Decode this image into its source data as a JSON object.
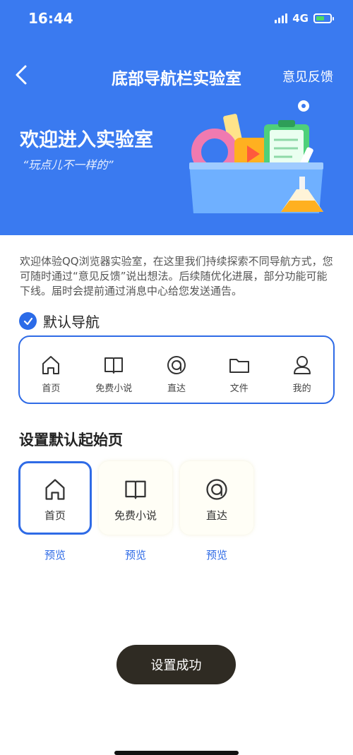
{
  "status_bar": {
    "time": "16:44",
    "network": "4G"
  },
  "nav": {
    "title": "底部导航栏实验室",
    "feedback": "意见反馈"
  },
  "hero": {
    "title": "欢迎进入实验室",
    "slogan": "“玩点儿不一样的”"
  },
  "intro": "欢迎体验QQ浏览器实验室，在这里我们持续探索不同导航方式，您可随时通过“意见反馈”说出想法。后续随优化进展，部分功能可能下线。届时会提前通过消息中心给您发送通告。",
  "default_nav": {
    "label": "默认导航",
    "checked": true,
    "items": [
      {
        "label": "首页",
        "icon": "home-icon"
      },
      {
        "label": "免费小说",
        "icon": "book-icon"
      },
      {
        "label": "直达",
        "icon": "direct-icon"
      },
      {
        "label": "文件",
        "icon": "folder-icon"
      },
      {
        "label": "我的",
        "icon": "profile-icon"
      }
    ]
  },
  "start_page": {
    "title": "设置默认起始页",
    "options": [
      {
        "label": "首页",
        "icon": "home-icon",
        "preview": "预览",
        "selected": true
      },
      {
        "label": "免费小说",
        "icon": "book-icon",
        "preview": "预览",
        "selected": false
      },
      {
        "label": "直达",
        "icon": "direct-icon",
        "preview": "预览",
        "selected": false
      }
    ]
  },
  "toast": {
    "label": "设置成功"
  },
  "colors": {
    "hero_bg": "#3a7af0",
    "accent": "#2f6be6",
    "toast_bg": "#2f2b23"
  }
}
